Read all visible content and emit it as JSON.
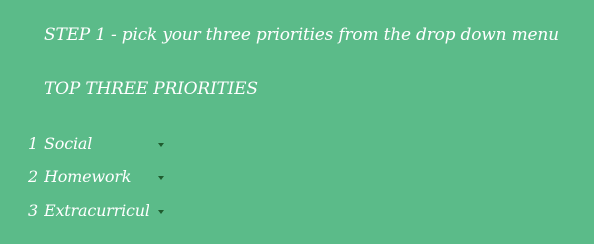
{
  "instructions": {
    "step_text": "STEP 1 - pick your three priorities from the drop down menu",
    "heading": "TOP THREE PRIORITIES"
  },
  "priorities": [
    {
      "number": "1",
      "selected": "Social"
    },
    {
      "number": "2",
      "selected": "Homework"
    },
    {
      "number": "3",
      "selected": "Extracurricular"
    }
  ],
  "colors": {
    "background": "#5bbb89",
    "text": "#ffffff",
    "dropdown_arrow": "#1f5c2f"
  },
  "icons": {
    "dropdown": "caret-down-icon"
  }
}
